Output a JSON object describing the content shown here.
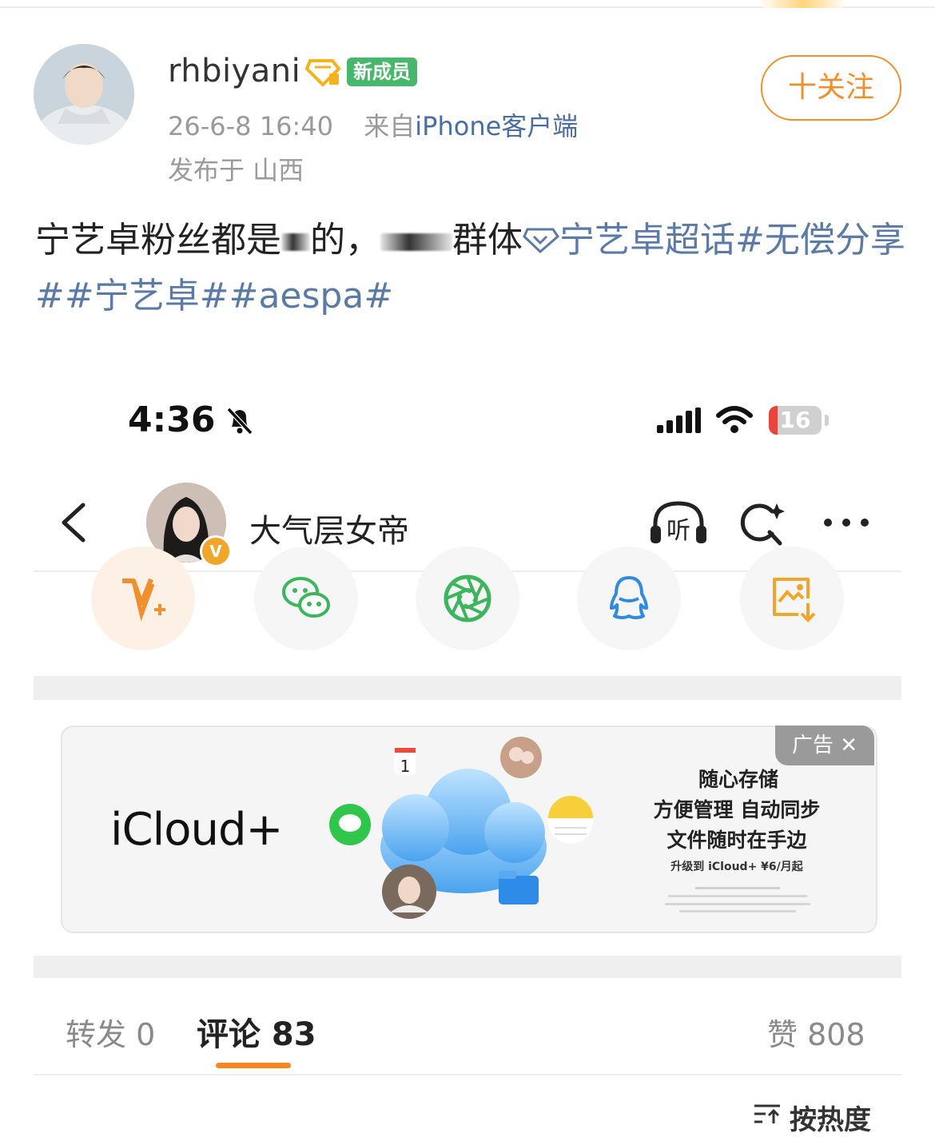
{
  "post": {
    "username": "rhbiyani",
    "member_badge": "新成员",
    "timestamp": "26-6-8 16:40",
    "source_prefix": "来自",
    "source_client": "iPhone客户端",
    "location_label": "发布于 山西",
    "follow_label": "十关注",
    "text_part1": "宁艺卓粉丝都是",
    "text_part2": "的，",
    "text_part3": "群体",
    "supertopic": "宁艺卓超话",
    "hashtags": "#无偿分享##宁艺卓##",
    "hashtag_last": "aespa#",
    "link_color": "#5b7aa6",
    "accent_color": "#f08f2e"
  },
  "screenshot": {
    "status": {
      "time": "4:36",
      "battery": "16",
      "battery_level": 0.16
    },
    "nav": {
      "title": "大气层女帝",
      "avatar_badge": "V",
      "listen_label": "听"
    },
    "share_icons": [
      "vplus-icon",
      "wechat-icon",
      "moments-icon",
      "qq-icon",
      "save-image-icon"
    ],
    "ad": {
      "label": "广告",
      "close": "✕",
      "brand": "iCloud+",
      "line1": "随心存储",
      "line2": "方便管理 自动同步",
      "line3": "文件随时在手边",
      "line4": "升级到 iCloud+ ¥6/月起",
      "calendar_day": "1"
    },
    "tabs": {
      "repost": "转发 0",
      "comment": "评论 83",
      "like": "赞 808",
      "sort": "按热度"
    }
  }
}
